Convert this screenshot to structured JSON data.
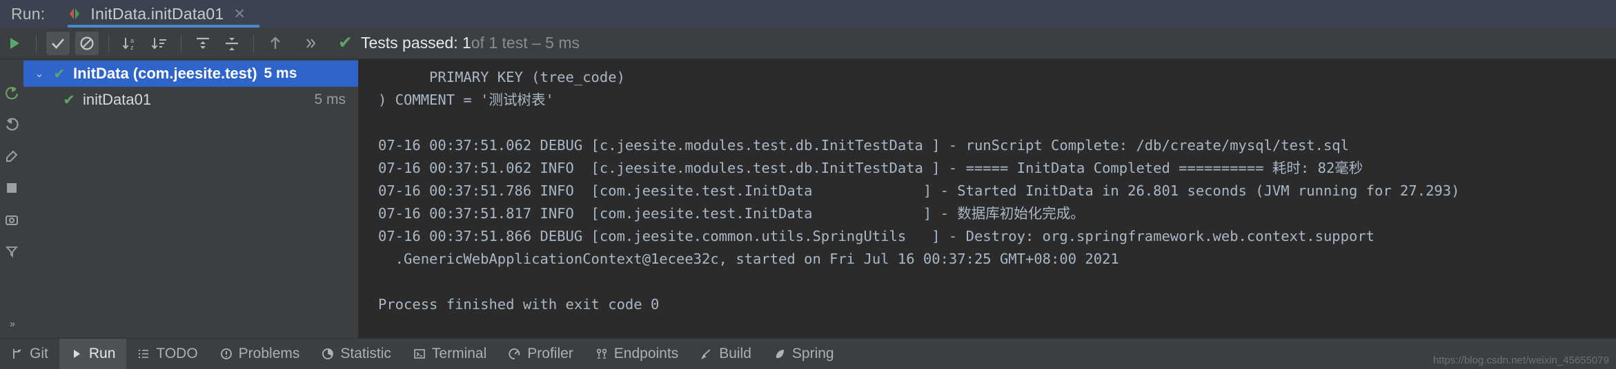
{
  "header": {
    "run_label": "Run:",
    "tab_title": "InitData.initData01",
    "close_glyph": "✕",
    "accent_color": "#4A88C7"
  },
  "toolbar": {
    "icons": [
      {
        "name": "rerun-button",
        "glyph": "▶"
      },
      {
        "name": "show-passed-toggle",
        "glyph": "✔"
      },
      {
        "name": "show-ignored-toggle",
        "glyph": "⊘"
      },
      {
        "name": "sort-alphabetically-button",
        "glyph": "↓a"
      },
      {
        "name": "sort-by-duration-button",
        "glyph": "↓≡"
      },
      {
        "name": "expand-all-button",
        "glyph": "⤒"
      },
      {
        "name": "collapse-all-button",
        "glyph": "⤓"
      },
      {
        "name": "previous-failed-test-button",
        "glyph": "↑"
      },
      {
        "name": "more-options-button",
        "glyph": "››"
      }
    ],
    "status_check": "✔",
    "status_main": "Tests passed: 1",
    "status_dim": " of 1 test – 5 ms"
  },
  "gutter": {
    "icons": [
      {
        "name": "rerun-gutter-icon"
      },
      {
        "name": "rerun-failed-gutter-icon"
      },
      {
        "name": "settings-gutter-icon"
      },
      {
        "name": "stop-gutter-icon"
      },
      {
        "name": "screenshot-gutter-icon"
      },
      {
        "name": "toggle-filter-gutter-icon"
      }
    ],
    "expand_glyph": "››"
  },
  "test_tree": {
    "rows": [
      {
        "name": "test-suite-row",
        "twirl": "⌄",
        "check": "✔",
        "label": "InitData (com.jeesite.test)",
        "time": "5 ms",
        "selected": true,
        "child": false
      },
      {
        "name": "test-case-row",
        "twirl": "",
        "check": "✔",
        "label": "initData01",
        "time": "5 ms",
        "selected": false,
        "child": true
      }
    ]
  },
  "console": {
    "lines": [
      "      PRIMARY KEY (tree_code)",
      ") COMMENT = '测试树表'",
      "",
      "07-16 00:37:51.062 DEBUG [c.jeesite.modules.test.db.InitTestData ] - runScript Complete: /db/create/mysql/test.sql",
      "07-16 00:37:51.062 INFO  [c.jeesite.modules.test.db.InitTestData ] - ===== InitData Completed ========== 耗时: 82毫秒",
      "07-16 00:37:51.786 INFO  [com.jeesite.test.InitData             ] - Started InitData in 26.801 seconds (JVM running for 27.293)",
      "07-16 00:37:51.817 INFO  [com.jeesite.test.InitData             ] - 数据库初始化完成。",
      "07-16 00:37:51.866 DEBUG [com.jeesite.common.utils.SpringUtils   ] - Destroy: org.springframework.web.context.support",
      "  .GenericWebApplicationContext@1ecee32c, started on Fri Jul 16 00:37:25 GMT+08:00 2021",
      "",
      "Process finished with exit code 0"
    ]
  },
  "statusbar": {
    "tabs": [
      {
        "name": "statusbar-tab-git",
        "label": "Git",
        "icon": "branch-icon",
        "active": false
      },
      {
        "name": "statusbar-tab-run",
        "label": "Run",
        "icon": "play-icon",
        "active": true
      },
      {
        "name": "statusbar-tab-todo",
        "label": "TODO",
        "icon": "list-icon",
        "active": false
      },
      {
        "name": "statusbar-tab-problems",
        "label": "Problems",
        "icon": "warning-icon",
        "active": false
      },
      {
        "name": "statusbar-tab-statistic",
        "label": "Statistic",
        "icon": "pie-icon",
        "active": false
      },
      {
        "name": "statusbar-tab-terminal",
        "label": "Terminal",
        "icon": "terminal-icon",
        "active": false
      },
      {
        "name": "statusbar-tab-profiler",
        "label": "Profiler",
        "icon": "gauge-icon",
        "active": false
      },
      {
        "name": "statusbar-tab-endpoints",
        "label": "Endpoints",
        "icon": "endpoints-icon",
        "active": false
      },
      {
        "name": "statusbar-tab-build",
        "label": "Build",
        "icon": "hammer-icon",
        "active": false
      },
      {
        "name": "statusbar-tab-spring",
        "label": "Spring",
        "icon": "leaf-icon",
        "active": false
      }
    ],
    "watermark": "https://blog.csdn.net/weixin_45655079"
  }
}
